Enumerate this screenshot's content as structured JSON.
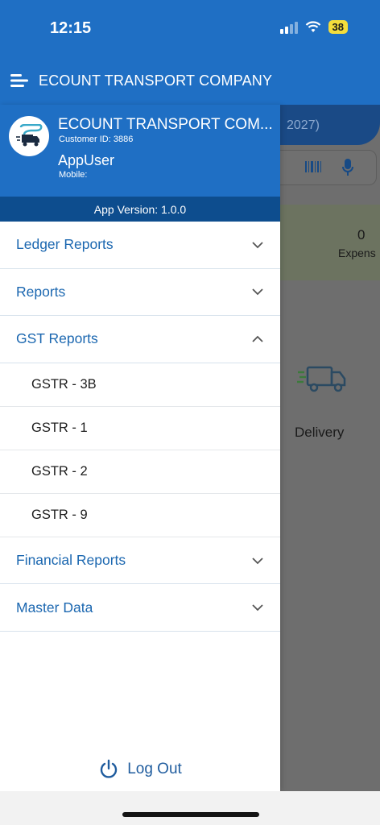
{
  "status_bar": {
    "time": "12:15",
    "battery": "38"
  },
  "app_bar": {
    "title": "ECOUNT TRANSPORT COMPANY"
  },
  "drawer": {
    "company_name": "ECOUNT TRANSPORT COM...",
    "customer_id": "Customer ID: 3886",
    "user_name": "AppUser",
    "mobile_label": "Mobile:",
    "app_version": "App Version: 1.0.0"
  },
  "menu": {
    "ledger_reports": "Ledger Reports",
    "reports": "Reports",
    "gst_reports": "GST Reports",
    "gst_items": [
      "GSTR - 3B",
      "GSTR - 1",
      "GSTR - 2",
      "GSTR - 9"
    ],
    "financial_reports": "Financial Reports",
    "master_data": "Master Data"
  },
  "logout_label": "Log Out",
  "background": {
    "year_text": "2027)",
    "stat_value": "0",
    "stat_label": "Expens",
    "delivery_label": "Delivery"
  },
  "colors": {
    "primary": "#1f6fc4",
    "primary_dark": "#0d4d8e",
    "menu_text": "#1b67b0",
    "battery": "#f4dd3b"
  }
}
